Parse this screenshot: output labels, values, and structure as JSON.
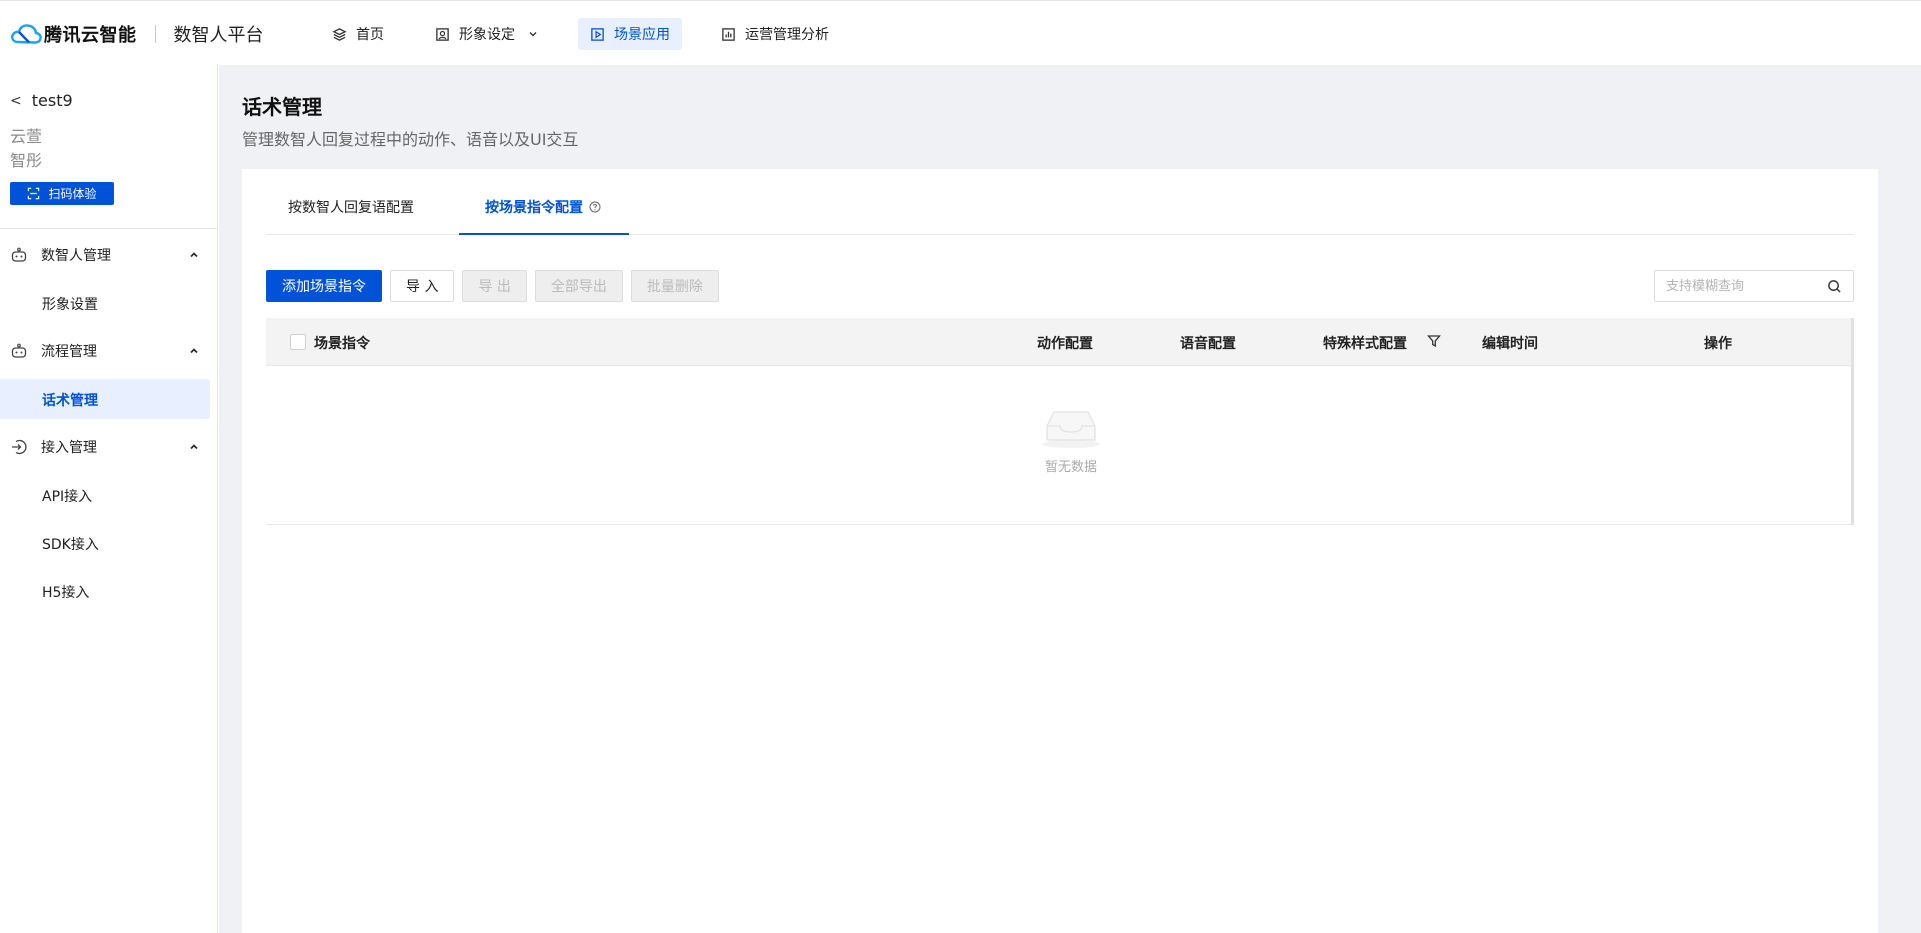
{
  "header": {
    "brand": "腾讯云智能",
    "platform": "数智人平台",
    "nav": [
      {
        "label": "首页",
        "icon": "layers-icon"
      },
      {
        "label": "形象设定",
        "icon": "portrait-icon"
      },
      {
        "label": "场景应用",
        "icon": "play-square-icon"
      },
      {
        "label": "运营管理分析",
        "icon": "bar-chart-icon"
      }
    ]
  },
  "sidebar": {
    "project": "test9",
    "org_line1": "云萱",
    "org_line2": "智彤",
    "scan_button": "扫码体验",
    "groups": [
      {
        "label": "数智人管理",
        "items": [
          "形象设置"
        ]
      },
      {
        "label": "流程管理",
        "items": [
          "话术管理"
        ]
      },
      {
        "label": "接入管理",
        "items": [
          "API接入",
          "SDK接入",
          "H5接入"
        ]
      }
    ]
  },
  "main": {
    "title": "话术管理",
    "description": "管理数智人回复过程中的动作、语音以及UI交互",
    "tabs": [
      "按数智人回复语配置",
      "按场景指令配置"
    ],
    "toolbar": {
      "add": "添加场景指令",
      "import": "导 入",
      "export": "导 出",
      "export_all": "全部导出",
      "batch_delete": "批量删除"
    },
    "search_placeholder": "支持模糊查询",
    "table": {
      "columns": [
        "场景指令",
        "动作配置",
        "语音配置",
        "特殊样式配置",
        "编辑时间",
        "操作"
      ],
      "empty_text": "暂无数据"
    }
  },
  "colors": {
    "primary": "#0052d9",
    "active_bg": "#e8efff",
    "page_bg": "#f0f1f5"
  }
}
